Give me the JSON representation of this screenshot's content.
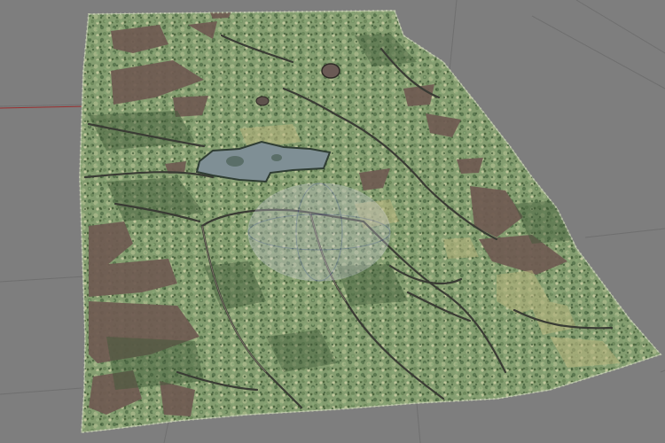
{
  "viewport": {
    "background_color": "#7e7e7e",
    "grid_line_color": "#6f6f6f",
    "grid_highlight_color": "#9a2f2f"
  },
  "model": {
    "name": "",
    "texture_colors": {
      "forest": "#7f9a6b",
      "forest_dark": "#4d6a43",
      "forest_light": "#a7b885",
      "clearing": "#6f5b52",
      "water": "#7f8f95",
      "track": "#3b3d36"
    }
  }
}
